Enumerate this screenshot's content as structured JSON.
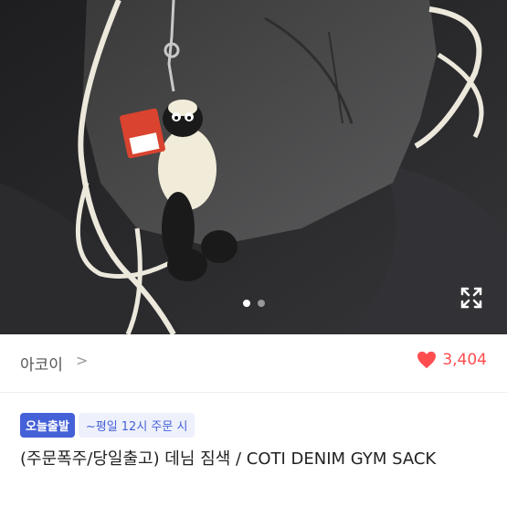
{
  "product": {
    "image": {
      "description": "product photo",
      "carousel": {
        "total": 2,
        "active": 1
      }
    },
    "expand_icon": "expand-icon"
  },
  "seller": {
    "name": "아코이",
    "chevron": ">"
  },
  "likes": {
    "count": "3,404",
    "icon": "heart-icon",
    "color": "#ff4d4f"
  },
  "shipping": {
    "badge": "오늘출발",
    "note": "~평일 12시 주문 시",
    "badge_color": "#4561d8"
  },
  "title": "(주문폭주/당일출고) 데님 짐색 / COTI DENIM GYM SACK"
}
